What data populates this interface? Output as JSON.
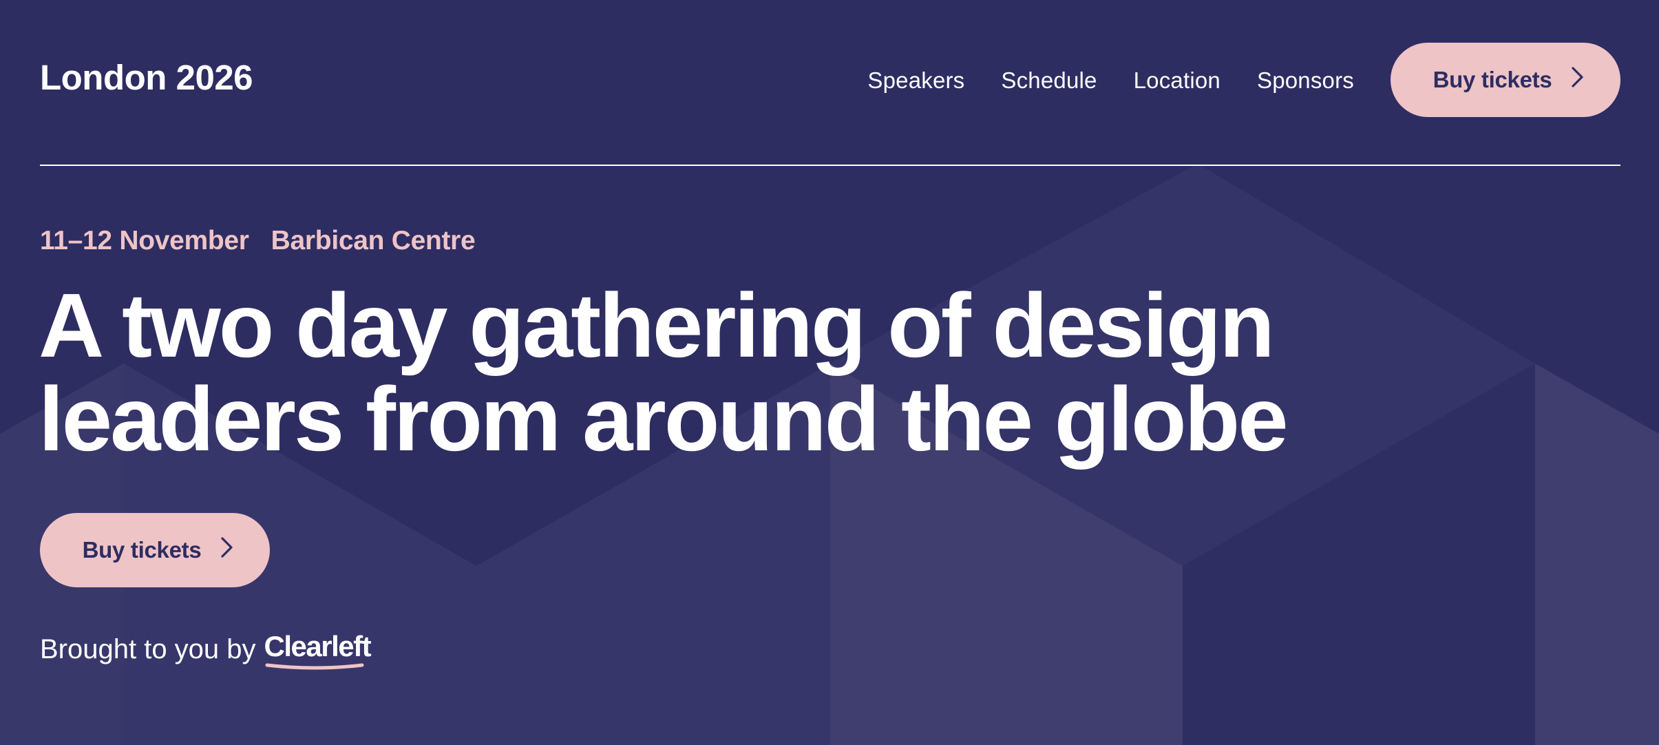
{
  "site": {
    "logo": "London 2026"
  },
  "nav": {
    "items": [
      {
        "label": "Speakers"
      },
      {
        "label": "Schedule"
      },
      {
        "label": "Location"
      },
      {
        "label": "Sponsors"
      }
    ],
    "cta_label": "Buy tickets"
  },
  "hero": {
    "date": "11–12 November",
    "venue": "Barbican Centre",
    "headline_line1": "A two day gathering of design",
    "headline_line2": "leaders from around the globe",
    "cta_label": "Buy tickets",
    "brought_by": "Brought to you by",
    "brand": "Clearleft"
  },
  "icons": {
    "cta": "chevron-right-icon"
  },
  "colors": {
    "background": "#2e2d62",
    "accent": "#eec4c7",
    "text": "#ffffff",
    "shape_light": "#3f3e6e",
    "shape_mid": "#37366a"
  }
}
